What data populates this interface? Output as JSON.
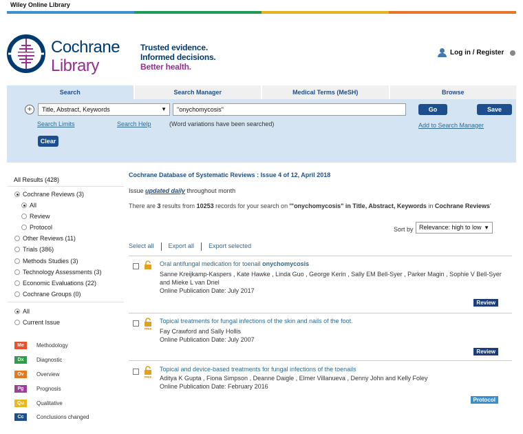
{
  "brand": {
    "top_label": "Wiley Online Library",
    "stripe_colors": [
      "#3e8ed0",
      "#1f9b57",
      "#e6b020",
      "#e5752a"
    ],
    "logo_line1": "Cochrane",
    "logo_line2": "Library",
    "tagline": [
      "Trusted evidence.",
      "Informed decisions.",
      "Better health."
    ]
  },
  "header": {
    "login_label": "Log in / Register"
  },
  "tabs": [
    {
      "label": "Search",
      "active": true
    },
    {
      "label": "Search Manager"
    },
    {
      "label": "Medical Terms (MeSH)"
    },
    {
      "label": "Browse"
    }
  ],
  "search": {
    "field": "Title, Abstract, Keywords",
    "query": "\"onychomycosis\"",
    "go_label": "Go",
    "save_label": "Save",
    "search_limits": "Search Limits",
    "search_help": "Search Help",
    "variation_note": "(Word variations have been searched)",
    "add_to_manager": "Add to Search Manager",
    "clear_label": "Clear"
  },
  "sidebar": {
    "all_results": "All Results (428)",
    "groups": [
      {
        "label": "Cochrane Reviews (3)",
        "selected": true,
        "sub": [
          {
            "label": "All",
            "selected": true
          },
          {
            "label": "Review"
          },
          {
            "label": "Protocol"
          }
        ]
      },
      {
        "label": "Other Reviews (11)"
      },
      {
        "label": "Trials (386)"
      },
      {
        "label": "Methods Studies (3)"
      },
      {
        "label": "Technology Assessments (3)"
      },
      {
        "label": "Economic Evaluations (22)"
      },
      {
        "label": "Cochrane Groups (0)"
      }
    ],
    "issue_filter": [
      {
        "label": "All",
        "selected": true
      },
      {
        "label": "Current Issue"
      }
    ],
    "legend": [
      {
        "code": "Me",
        "label": "Methodology",
        "color": "#e4532c"
      },
      {
        "code": "Dx",
        "label": "Diagnostic",
        "color": "#2f9e4a"
      },
      {
        "code": "Ov",
        "label": "Overview",
        "color": "#e07b22"
      },
      {
        "code": "Pg",
        "label": "Prognosis",
        "color": "#9c3f98"
      },
      {
        "code": "Qu",
        "label": "Qualitative",
        "color": "#e8b81f"
      },
      {
        "code": "Cc",
        "label": "Conclusions changed",
        "color": "#1d4f8e"
      }
    ]
  },
  "results": {
    "db_title": "Cochrane Database of Systematic Reviews : Issue 4 of 12, April 2018",
    "issue_prefix": "Issue ",
    "issue_link": "updated daily",
    "issue_suffix": " throughout month",
    "summary_a": "There are ",
    "summary_count": "3",
    "summary_b": " results from ",
    "summary_records": "10253",
    "summary_c": " records for your search on ",
    "summary_query": "'\"onychomycosis\" in Title, Abstract, Keywords",
    "summary_d": " in ",
    "summary_scope": "Cochrane Reviews",
    "summary_e": "'",
    "sort_label": "Sort by",
    "sort_value": "Relevance: high to low",
    "actions": [
      "Select all",
      "Export all",
      "Export selected"
    ],
    "free_label": "FREE",
    "items": [
      {
        "title_pre": "Oral antifungal medication for toenail ",
        "title_bold": "onychomycosis",
        "authors": "Sanne Kreijkamp-Kaspers , Kate Hawke , Linda Guo , George Kerin , Sally EM Bell-Syer , Parker Magin , Sophie V Bell-Syer and Mieke L van Driel",
        "date": "Online Publication Date: July 2017",
        "type": "Review",
        "type_color": "#1d3d7a",
        "free": false
      },
      {
        "title_pre": "Topical treatments for fungal infections of the skin and nails of the foot.",
        "title_bold": "",
        "authors": "Fay Crawford and Sally Hollis",
        "date": "Online Publication Date: July 2007",
        "type": "Review",
        "type_color": "#1d3d7a",
        "free": true
      },
      {
        "title_pre": "Topical and device-based treatments for fungal infections of the toenails",
        "title_bold": "",
        "authors": "Aditya K Gupta , Fiona Simpson , Deanne Daigle , Elmer Villanueva , Denny John and Kelly Foley",
        "date": "Online Publication Date: February 2016",
        "type": "Protocol",
        "type_color": "#3a8fd0",
        "free": true
      }
    ]
  }
}
